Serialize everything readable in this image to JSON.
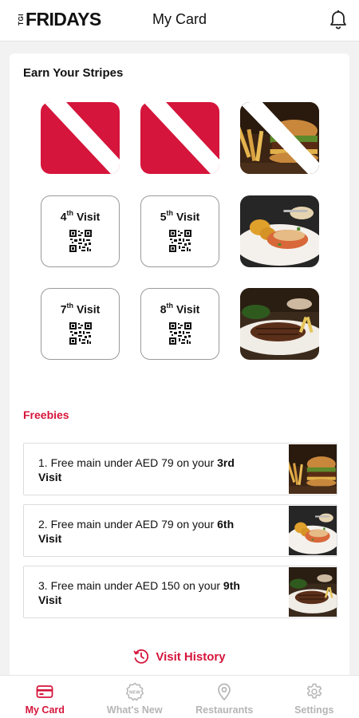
{
  "header": {
    "logo_prefix": "TGI",
    "logo_text": "FRIDAYS",
    "title": "My Card",
    "bell_icon": "bell-icon"
  },
  "stripes": {
    "title": "Earn Your Stripes",
    "stamps": [
      {
        "type": "stripe"
      },
      {
        "type": "stripe"
      },
      {
        "type": "photo-stripe",
        "photo": "burger-fries"
      },
      {
        "type": "visit",
        "num": "4",
        "suffix": "th",
        "word": "Visit"
      },
      {
        "type": "visit",
        "num": "5",
        "suffix": "th",
        "word": "Visit"
      },
      {
        "type": "photo",
        "photo": "chicken-plate"
      },
      {
        "type": "visit",
        "num": "7",
        "suffix": "th",
        "word": "Visit"
      },
      {
        "type": "visit",
        "num": "8",
        "suffix": "th",
        "word": "Visit"
      },
      {
        "type": "photo",
        "photo": "steak-plate"
      }
    ]
  },
  "freebies": {
    "title": "Freebies",
    "items": [
      {
        "prefix": "1. Free main under AED 79 on your ",
        "bold1": "3rd",
        "line2": "Visit",
        "photo": "burger-fries"
      },
      {
        "prefix": "2. Free main under AED 79 on your ",
        "bold1": "6th",
        "line2": "Visit",
        "photo": "chicken-plate"
      },
      {
        "prefix": "3. Free main under AED 150 on your ",
        "bold1": "9th",
        "line2": "Visit",
        "photo": "steak-plate"
      }
    ]
  },
  "history": {
    "label": "Visit History",
    "icon": "history-clock-icon"
  },
  "tabs": [
    {
      "label": "My Card",
      "icon": "card-icon",
      "active": true
    },
    {
      "label": "What's New",
      "icon": "new-badge-icon",
      "active": false
    },
    {
      "label": "Restaurants",
      "icon": "location-pin-icon",
      "active": false
    },
    {
      "label": "Settings",
      "icon": "gear-icon",
      "active": false
    }
  ],
  "colors": {
    "brand_red": "#d5153b",
    "inactive_gray": "#b5b5b5"
  }
}
